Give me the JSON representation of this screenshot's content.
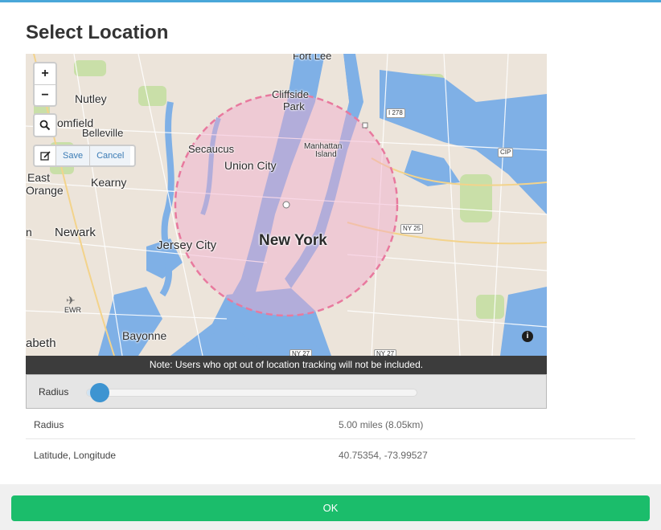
{
  "dialog": {
    "title": "Select Location"
  },
  "map": {
    "controls": {
      "zoom_in": "+",
      "zoom_out": "−",
      "search_icon": "search-icon",
      "edit_icon": "edit-icon",
      "save_label": "Save",
      "cancel_label": "Cancel",
      "info_icon": "i"
    },
    "places": {
      "fort_lee": "Fort Lee",
      "cliffside": "Cliffside",
      "park": "Park",
      "nutley": "Nutley",
      "bloomfield": "omfield",
      "belleville": "Belleville",
      "secaucus": "Secaucus",
      "union_city": "Union City",
      "manhattan": "Manhattan",
      "island": "Island",
      "east": "East",
      "orange": "Orange",
      "kearny": "Kearny",
      "newark": "Newark",
      "jersey_city": "Jersey City",
      "new_york": "New York",
      "ewr": "EWR",
      "bayonne": "Bayonne",
      "elizabeth": "abeth",
      "n_fragment": "n"
    },
    "shields": {
      "i278": "I 278",
      "cip": "CIP",
      "ny25": "NY 25",
      "ny27a": "NY 27",
      "ny27b": "NY 27"
    },
    "colors": {
      "water": "#7fb0e6",
      "land": "#ece4da",
      "park": "#c9dfa8",
      "radius_circle": "#e8799e"
    },
    "note": "Note: Users who opt out of location tracking will not be included."
  },
  "radius_control": {
    "label": "Radius",
    "value_fraction": 0.04
  },
  "details": {
    "radius_label": "Radius",
    "radius_value": "5.00 miles (8.05km)",
    "latlng_label": "Latitude, Longitude",
    "latlng_value": "40.75354, -73.99527"
  },
  "footer": {
    "ok_label": "OK"
  }
}
